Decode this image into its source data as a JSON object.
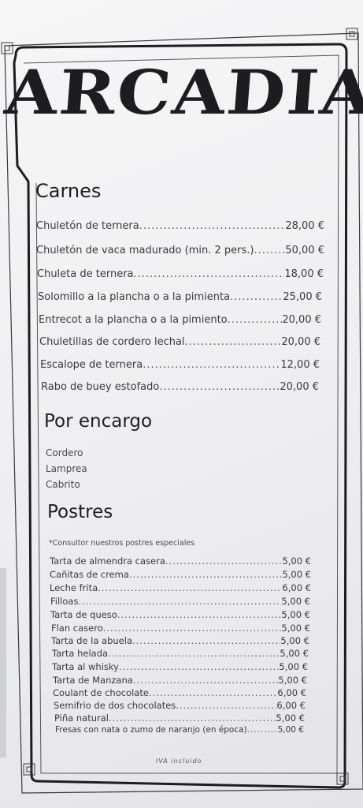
{
  "restaurant_name": "ARCADIA",
  "sections": {
    "carnes": {
      "title": "Carnes",
      "items": [
        {
          "name": "Chuletón de ternera",
          "price": "28,00 €"
        },
        {
          "name": "Chuletón de vaca madurado (min. 2 pers.)",
          "price": "50,00 €"
        },
        {
          "name": "Chuleta de ternera",
          "price": "18,00 €"
        },
        {
          "name": "Solomillo a la plancha o a la pimienta",
          "price": "25,00 €"
        },
        {
          "name": "Entrecot a la plancha o a la pimiento",
          "price": "20,00 €"
        },
        {
          "name": "Chuletillas de cordero lechal",
          "price": "20,00 €"
        },
        {
          "name": "Escalope de ternera",
          "price": "12,00 €"
        },
        {
          "name": "Rabo de buey estofado",
          "price": "20,00 €"
        }
      ]
    },
    "por_encargo": {
      "title": "Por encargo",
      "items": [
        "Cordero",
        "Lamprea",
        "Cabrito"
      ]
    },
    "postres": {
      "title": "Postres",
      "note": "*Consultor nuestros postres especiales",
      "items": [
        {
          "name": "Tarta de almendra casera",
          "price": "5,00 €"
        },
        {
          "name": "Cañitas de crema",
          "price": "5,00 €"
        },
        {
          "name": "Leche frita",
          "price": "6,00 €"
        },
        {
          "name": "Filloas",
          "price": "5,00 €"
        },
        {
          "name": "Tarta de queso",
          "price": "5,00 €"
        },
        {
          "name": "Flan casero",
          "price": "5,00 €"
        },
        {
          "name": "Tarta de la abuela",
          "price": "5,00 €"
        },
        {
          "name": "Tarta helada",
          "price": "5,00 €"
        },
        {
          "name": "Tarta al whisky",
          "price": "5,00 €"
        },
        {
          "name": "Tarta de Manzana",
          "price": "5,00 €"
        },
        {
          "name": "Coulant de chocolate",
          "price": "6,00 €"
        },
        {
          "name": "Semifrio de dos chocolates",
          "price": "6,00 €"
        },
        {
          "name": "Piña natural",
          "price": "5,00 €"
        },
        {
          "name": "Fresas con nata o zumo de naranjo (en época)",
          "price": "5,00 €"
        }
      ]
    }
  },
  "footer_note": "IVA incluido",
  "colors": {
    "paper": "#f3f3f4",
    "ink": "#1d1d1f",
    "frame": "#2b2b2d"
  }
}
